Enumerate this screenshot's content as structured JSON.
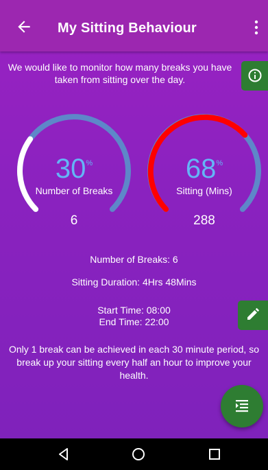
{
  "header": {
    "title": "My Sitting Behaviour"
  },
  "intro": {
    "text": "We would like to monitor how many breaks you have taken from sitting over the day."
  },
  "gauges": [
    {
      "percent": "30",
      "percent_sign": "%",
      "label": "Number of Breaks",
      "value": "6",
      "fill_fraction": 0.3,
      "color": "#ffffff"
    },
    {
      "percent": "68",
      "percent_sign": "%",
      "label": "Sitting (Mins)",
      "value": "288",
      "fill_fraction": 0.68,
      "color": "#ff0000"
    }
  ],
  "colors": {
    "track": "#5e87c9",
    "accent": "#64b5f6",
    "green": "#2e7d32",
    "background": "#8a22bf"
  },
  "stats": {
    "breaks": "Number of Breaks: 6",
    "duration": "Sitting Duration: 4Hrs 48Mins",
    "start": "Start Time: 08:00",
    "end": "End Time: 22:00"
  },
  "note": {
    "text": "Only 1 break can be achieved in each 30 minute period, so break up your sitting every half an hour to improve your health."
  },
  "icons": {
    "back": "arrow-back-icon",
    "overflow": "more-vert-icon",
    "info": "info-icon",
    "edit": "pencil-icon",
    "fab": "list-icon"
  }
}
